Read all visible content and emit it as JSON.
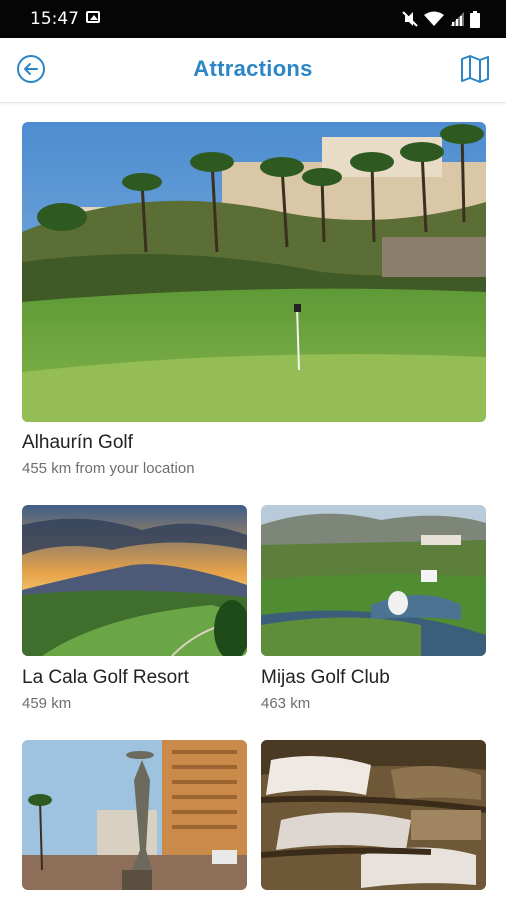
{
  "status_bar": {
    "time": "15:47",
    "icons": [
      "gallery-icon",
      "mute-icon",
      "wifi-icon",
      "signal-icon",
      "battery-icon"
    ]
  },
  "header": {
    "title": "Attractions",
    "back_icon": "arrow-left-circle-icon",
    "map_icon": "map-icon",
    "accent_color": "#2b86c5"
  },
  "attractions": [
    {
      "name": "Alhaurín Golf",
      "distance": "455 km from your location"
    },
    {
      "name": "La Cala Golf Resort",
      "distance": "459 km"
    },
    {
      "name": "Mijas Golf Club",
      "distance": "463 km"
    }
  ]
}
